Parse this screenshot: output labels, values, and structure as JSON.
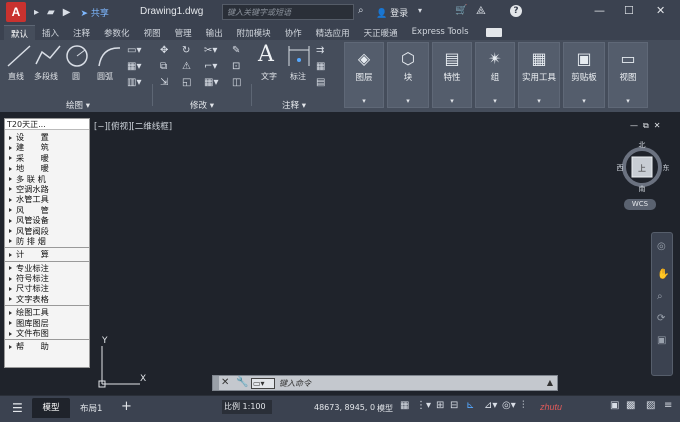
{
  "titlebar": {
    "logo": "A",
    "share": "共享",
    "title": "Drawing1.dwg",
    "search_placeholder": "键入关键字或短语",
    "login": "登录",
    "help": "?"
  },
  "tabs": [
    "默认",
    "插入",
    "注释",
    "参数化",
    "视图",
    "管理",
    "输出",
    "附加模块",
    "协作",
    "精选应用",
    "天正暖通",
    "Express Tools"
  ],
  "ribbon": {
    "draw_tools": [
      "直线",
      "多段线",
      "圆",
      "圆弧"
    ],
    "panels": {
      "draw": "绘图",
      "modify": "修改",
      "annotation": "注释"
    },
    "annotation_tools": [
      "文字",
      "标注"
    ],
    "big_buttons": [
      "图层",
      "块",
      "特性",
      "组",
      "实用工具",
      "剪贴板",
      "视图"
    ]
  },
  "palette": {
    "title": "T20天正...",
    "groups": [
      [
        "设　　置",
        "建　　筑",
        "采　　暖",
        "地　　暖",
        "多 联 机",
        "空调水路",
        "水管工具",
        "风　　管",
        "风管设备",
        "风管阀段",
        "防 排 烟"
      ],
      [
        "计　　算"
      ],
      [
        "专业标注",
        "符号标注",
        "尺寸标注",
        "文字表格"
      ],
      [
        "绘图工具",
        "图库图层",
        "文件布图"
      ],
      [
        "帮　　助"
      ]
    ]
  },
  "viewport": {
    "label": "[−][俯视][二维线框]",
    "compass": {
      "n": "北",
      "s": "南",
      "e": "东",
      "w": "西",
      "center": "上"
    },
    "wcs": "WCS",
    "ucs_y": "Y",
    "ucs_x": "X"
  },
  "commandline": {
    "placeholder": "键入命令"
  },
  "statusbar": {
    "model_tab": "模型",
    "layout_tab": "布局1",
    "scale": "比例 1:100",
    "coords": "48673, 8945, 0",
    "model": "模型",
    "watermark": "zhutu"
  }
}
